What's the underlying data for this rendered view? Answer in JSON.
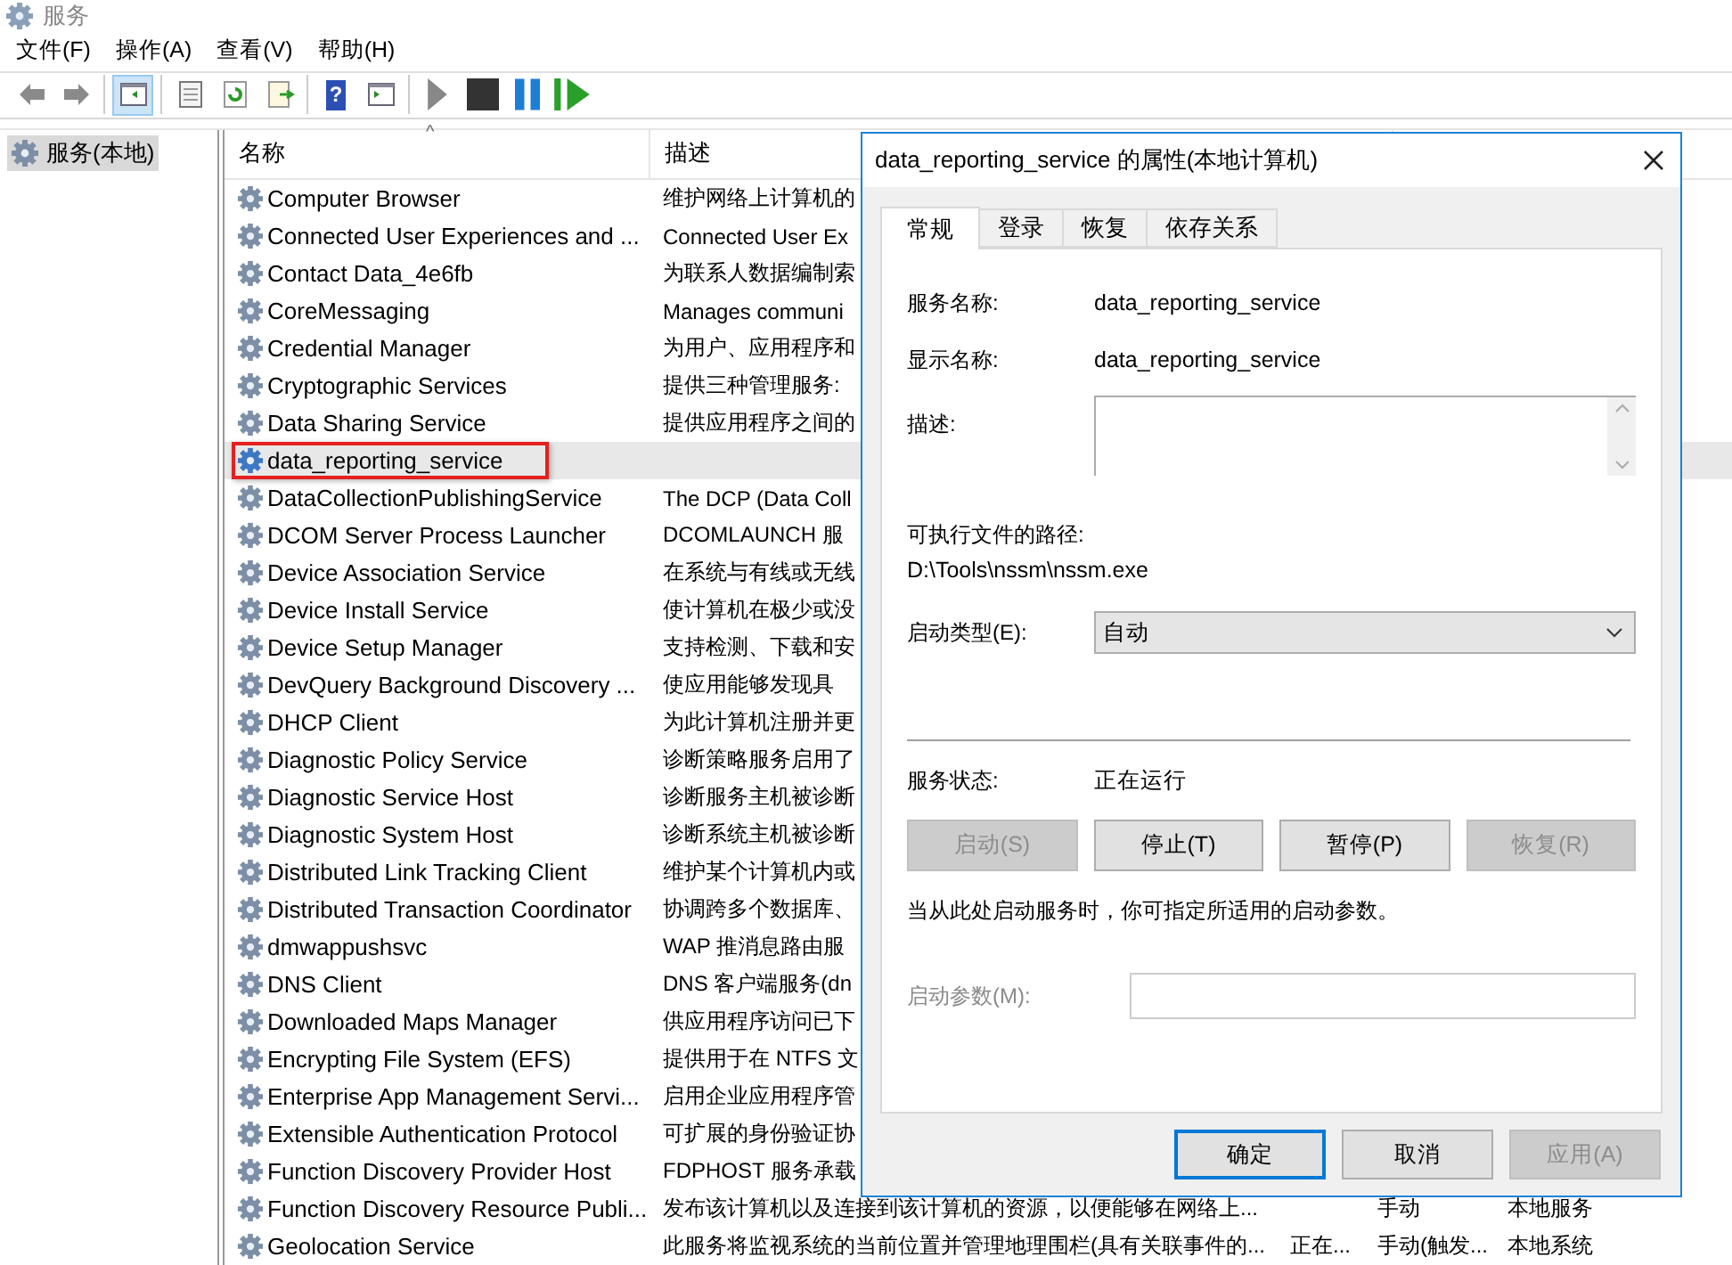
{
  "window": {
    "title": "服务"
  },
  "menu": [
    "文件(F)",
    "操作(A)",
    "查看(V)",
    "帮助(H)"
  ],
  "toolbar": [
    [
      {
        "kind": "back",
        "selected": false
      },
      {
        "kind": "forward",
        "selected": false
      }
    ],
    [
      {
        "kind": "tree",
        "selected": true
      }
    ],
    [
      {
        "kind": "properties",
        "selected": false
      },
      {
        "kind": "refresh",
        "selected": false
      },
      {
        "kind": "export",
        "selected": false
      }
    ],
    [
      {
        "kind": "help",
        "selected": false,
        "glyph": "?"
      },
      {
        "kind": "pane",
        "selected": false
      }
    ],
    [
      {
        "kind": "start",
        "selected": false
      },
      {
        "kind": "stop",
        "selected": false
      },
      {
        "kind": "pause",
        "selected": false
      },
      {
        "kind": "resume",
        "selected": false
      }
    ]
  ],
  "tree": [
    {
      "label": "服务(本地)",
      "selected": true
    }
  ],
  "list": {
    "sort_mark": "^",
    "columns": [
      "名称",
      "描述"
    ],
    "rows": [
      {
        "name": "Computer Browser",
        "description": "维护网络上计算机的",
        "selected": false,
        "annotated": false
      },
      {
        "name": "Connected User Experiences and ...",
        "description": "Connected User Ex",
        "selected": false,
        "annotated": false
      },
      {
        "name": "Contact Data_4e6fb",
        "description": "为联系人数据编制索",
        "selected": false,
        "annotated": false
      },
      {
        "name": "CoreMessaging",
        "description": "Manages communi",
        "selected": false,
        "annotated": false
      },
      {
        "name": "Credential Manager",
        "description": "为用户、应用程序和",
        "selected": false,
        "annotated": false
      },
      {
        "name": "Cryptographic Services",
        "description": "提供三种管理服务:",
        "selected": false,
        "annotated": false
      },
      {
        "name": "Data Sharing Service",
        "description": "提供应用程序之间的",
        "selected": false,
        "annotated": false
      },
      {
        "name": "data_reporting_service",
        "selected": true,
        "annotated": true
      },
      {
        "name": "DataCollectionPublishingService",
        "description": "The DCP (Data Coll",
        "selected": false,
        "annotated": false
      },
      {
        "name": "DCOM Server Process Launcher",
        "description": "DCOMLAUNCH 服",
        "selected": false,
        "annotated": false
      },
      {
        "name": "Device Association Service",
        "description": "在系统与有线或无线",
        "selected": false,
        "annotated": false
      },
      {
        "name": "Device Install Service",
        "description": "使计算机在极少或没",
        "selected": false,
        "annotated": false
      },
      {
        "name": "Device Setup Manager",
        "description": "支持检测、下载和安",
        "selected": false,
        "annotated": false
      },
      {
        "name": "DevQuery Background Discovery ...",
        "description": "使应用能够发现具",
        "selected": false,
        "annotated": false
      },
      {
        "name": "DHCP Client",
        "description": "为此计算机注册并更",
        "selected": false,
        "annotated": false
      },
      {
        "name": "Diagnostic Policy Service",
        "description": "诊断策略服务启用了",
        "selected": false,
        "annotated": false
      },
      {
        "name": "Diagnostic Service Host",
        "description": "诊断服务主机被诊断",
        "selected": false,
        "annotated": false
      },
      {
        "name": "Diagnostic System Host",
        "description": "诊断系统主机被诊断",
        "selected": false,
        "annotated": false
      },
      {
        "name": "Distributed Link Tracking Client",
        "description": "维护某个计算机内或",
        "selected": false,
        "annotated": false
      },
      {
        "name": "Distributed Transaction Coordinator",
        "description": "协调跨多个数据库、",
        "selected": false,
        "annotated": false
      },
      {
        "name": "dmwappushsvc",
        "description": "WAP 推消息路由服",
        "selected": false,
        "annotated": false
      },
      {
        "name": "DNS Client",
        "description": "DNS 客户端服务(dn",
        "selected": false,
        "annotated": false
      },
      {
        "name": "Downloaded Maps Manager",
        "description": "供应用程序访问已下",
        "selected": false,
        "annotated": false
      },
      {
        "name": "Encrypting File System (EFS)",
        "description": "提供用于在 NTFS 文",
        "selected": false,
        "annotated": false
      },
      {
        "name": "Enterprise App Management Servi...",
        "description": "启用企业应用程序管",
        "selected": false,
        "annotated": false
      },
      {
        "name": "Extensible Authentication Protocol",
        "description": "可扩展的身份验证协",
        "selected": false,
        "annotated": false
      },
      {
        "name": "Function Discovery Provider Host",
        "description": "FDPHOST 服务承载",
        "selected": false,
        "annotated": false
      },
      {
        "name": "Function Discovery Resource Publi...",
        "description": "发布该计算机以及连接到该计算机的资源，以便能够在网络上...",
        "startup": "手动",
        "logon": "本地服务",
        "selected": false,
        "annotated": false
      },
      {
        "name": "Geolocation Service",
        "description": "此服务将监视系统的当前位置并管理地理围栏(具有关联事件的...",
        "status": "正在...",
        "startup": "手动(触发...",
        "logon": "本地系统",
        "selected": false,
        "annotated": false
      }
    ]
  },
  "dialog": {
    "title": "data_reporting_service 的属性(本地计算机)",
    "tabs": [
      {
        "label": "常规",
        "selected": true
      },
      {
        "label": "登录",
        "selected": false
      },
      {
        "label": "恢复",
        "selected": false
      },
      {
        "label": "依存关系",
        "selected": false
      }
    ],
    "service_name": {
      "label": "服务名称:",
      "value": "data_reporting_service"
    },
    "display_name": {
      "label": "显示名称:",
      "value": "data_reporting_service"
    },
    "description": {
      "label": "描述:"
    },
    "path": {
      "label": "可执行文件的路径:",
      "value": "D:\\Tools\\nssm\\nssm.exe"
    },
    "startup_type": {
      "label": "启动类型(E):",
      "value": "自动"
    },
    "status": {
      "label": "服务状态:",
      "value": "正在运行"
    },
    "controls": [
      {
        "label": "启动(S)",
        "disabled": true
      },
      {
        "label": "停止(T)",
        "disabled": false
      },
      {
        "label": "暂停(P)",
        "disabled": false
      },
      {
        "label": "恢复(R)",
        "disabled": true
      }
    ],
    "hint": "当从此处启动服务时，你可指定所适用的启动参数。",
    "parameters": {
      "label": "启动参数(M):",
      "disabled": true
    },
    "buttons": [
      {
        "label": "确定",
        "default": true,
        "disabled": false
      },
      {
        "label": "取消",
        "default": false,
        "disabled": false
      },
      {
        "label": "应用(A)",
        "default": false,
        "disabled": true
      }
    ]
  }
}
